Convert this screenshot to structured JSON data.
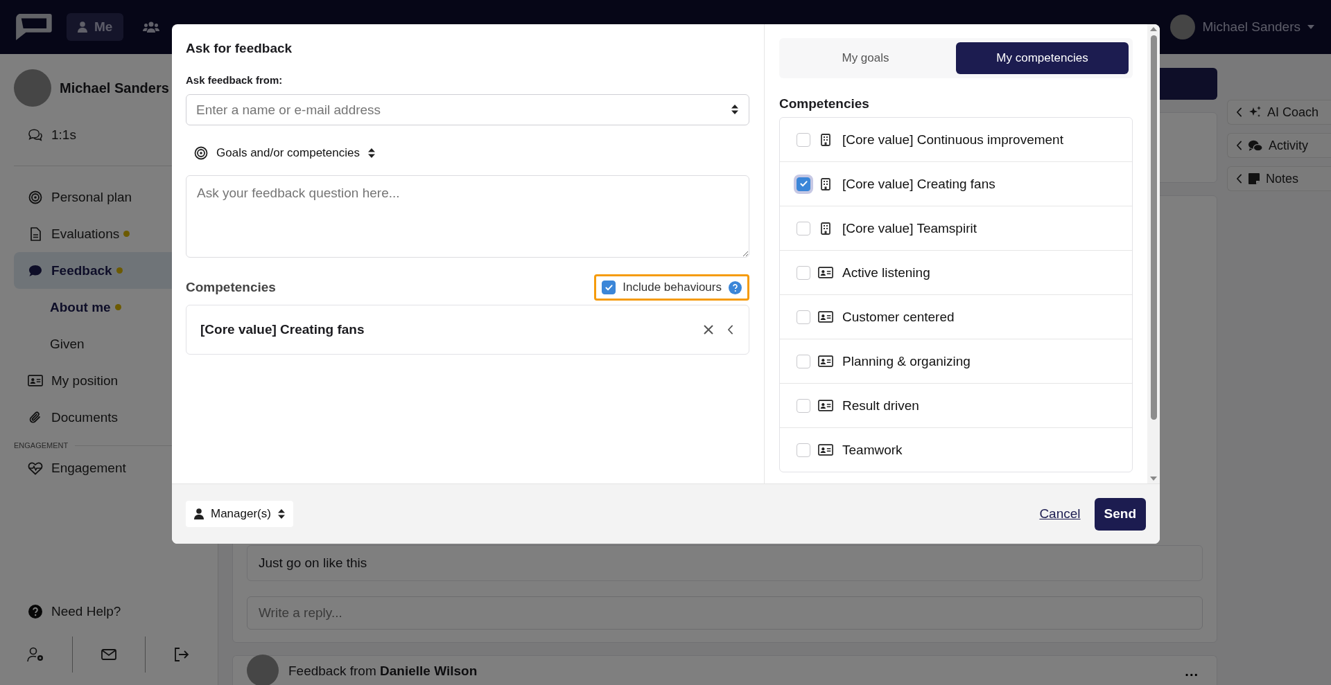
{
  "top_bar": {
    "nav": [
      {
        "label": "Me",
        "selected": true
      },
      {
        "selected": false
      }
    ],
    "user": {
      "name": "Michael Sanders"
    }
  },
  "sidebar": {
    "user": {
      "name": "Michael Sanders"
    },
    "groups": [
      {
        "items": [
          {
            "label": "1:1s",
            "selected": false,
            "dot": false
          }
        ]
      },
      {
        "items": [
          {
            "label": "Personal plan",
            "selected": false,
            "dot": false
          },
          {
            "label": "Evaluations",
            "selected": false,
            "dot": true
          },
          {
            "label": "Feedback",
            "selected": true,
            "dot": true,
            "children": [
              {
                "label": "About me",
                "selected": true,
                "dot": true
              },
              {
                "label": "Given",
                "selected": false,
                "dot": false
              }
            ]
          },
          {
            "label": "My position",
            "selected": false,
            "dot": false
          },
          {
            "label": "Documents",
            "selected": false,
            "dot": false
          }
        ]
      },
      {
        "title": "ENGAGEMENT",
        "items": [
          {
            "label": "Engagement",
            "selected": false,
            "dot": false
          }
        ]
      }
    ],
    "help": "Need Help?"
  },
  "side_panel": {
    "buttons": [
      "AI Coach",
      "Activity",
      "Notes"
    ]
  },
  "main": {
    "comment": "Just go on like this",
    "reply_placeholder": "Write a reply...",
    "next_card": {
      "title": "Feedback from **Danielle Wilson**",
      "menu": "..."
    }
  },
  "modal": {
    "title": "Ask for feedback",
    "from_label": "Ask feedback from:",
    "from_placeholder": "Enter a name or e-mail address",
    "scope_select": "Goals and/or competencies",
    "question_placeholder": "Ask your feedback question here...",
    "competencies_heading": "Competencies",
    "include_behaviours": {
      "label": "Include behaviours",
      "checked": true
    },
    "selected_competencies": [
      "[Core value] Creating fans"
    ],
    "recipient_select": "Manager(s)",
    "cancel": "Cancel",
    "send": "Send",
    "tabs": [
      {
        "label": "My goals",
        "selected": false
      },
      {
        "label": "My competencies",
        "selected": true
      }
    ],
    "list_heading": "Competencies",
    "competencies": [
      {
        "label": "[Core value] Continuous improvement",
        "kind": "core-value",
        "checked": false,
        "focused": false
      },
      {
        "label": "[Core value] Creating fans",
        "kind": "core-value",
        "checked": true,
        "focused": true
      },
      {
        "label": "[Core value] Teamspirit",
        "kind": "core-value",
        "checked": false,
        "focused": false
      },
      {
        "label": "Active listening",
        "kind": "competency",
        "checked": false,
        "focused": false
      },
      {
        "label": "Customer centered",
        "kind": "competency",
        "checked": false,
        "focused": false
      },
      {
        "label": "Planning & organizing",
        "kind": "competency",
        "checked": false,
        "focused": false
      },
      {
        "label": "Result driven",
        "kind": "competency",
        "checked": false,
        "focused": false
      },
      {
        "label": "Teamwork",
        "kind": "competency",
        "checked": false,
        "focused": false
      }
    ]
  }
}
